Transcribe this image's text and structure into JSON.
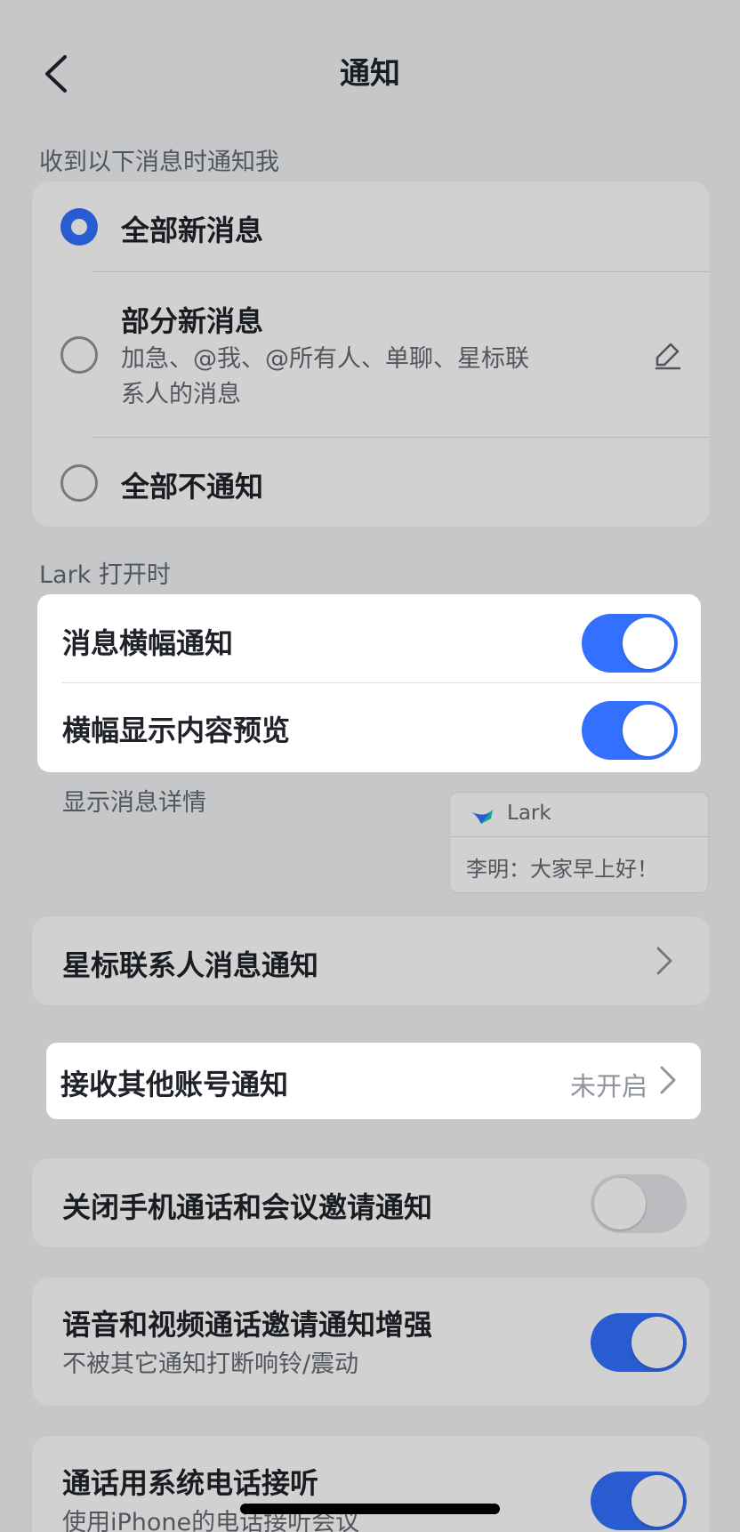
{
  "nav": {
    "title": "通知"
  },
  "section_receive": {
    "label": "收到以下消息时通知我",
    "options": [
      {
        "title": "全部新消息",
        "selected": true
      },
      {
        "title": "部分新消息",
        "subtitle": "加急、@我、@所有人、单聊、星标联系人的消息",
        "selected": false,
        "edit_icon": "edit-icon"
      },
      {
        "title": "全部不通知",
        "selected": false
      }
    ]
  },
  "section_lark_open": {
    "label": "Lark 打开时",
    "items": [
      {
        "title": "消息横幅通知",
        "on": true
      },
      {
        "title": "横幅显示内容预览",
        "on": true
      }
    ],
    "detail_label": "显示消息详情",
    "preview": {
      "app": "Lark",
      "message": "李明：大家早上好！"
    }
  },
  "starred": {
    "title": "星标联系人消息通知"
  },
  "other_accounts": {
    "title": "接收其他账号通知",
    "status": "未开启"
  },
  "close_call_invites": {
    "title": "关闭手机通话和会议邀请通知",
    "on": false
  },
  "enhance_call": {
    "title": "语音和视频通话邀请通知增强",
    "subtitle": "不被其它通知打断响铃/震动",
    "on": true
  },
  "system_phone": {
    "title": "通话用系统电话接听",
    "subtitle": "使用iPhone的电话接听会议",
    "on": true
  },
  "colors": {
    "accent": "#3370ff",
    "background": "#f2f3f5",
    "card": "#ffffff",
    "text": "#1f2329",
    "secondary": "#646a73"
  }
}
